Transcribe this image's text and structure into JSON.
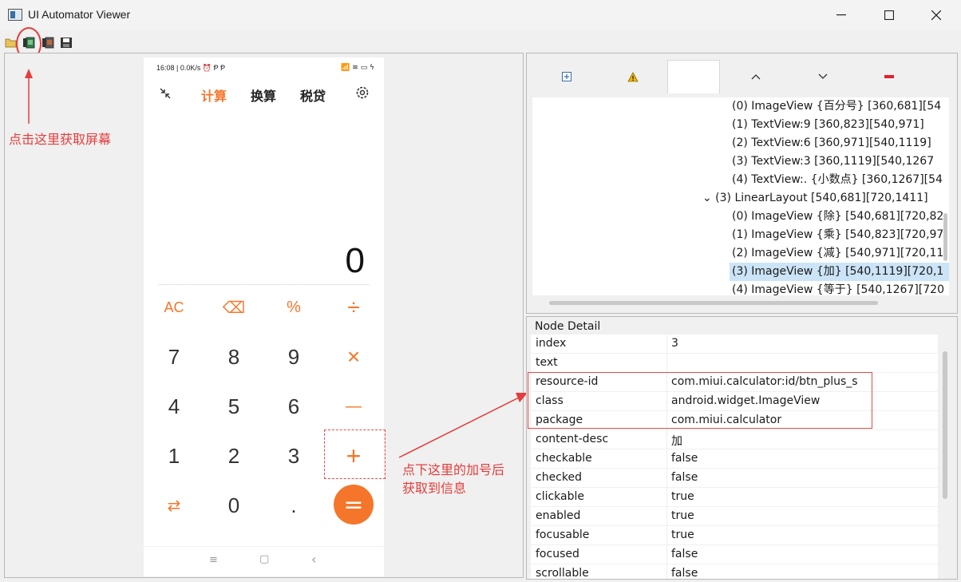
{
  "window": {
    "title": "UI Automator Viewer"
  },
  "toolbar": {
    "icons": [
      "open-folder-icon",
      "device-screenshot-icon",
      "device-screenshot-compressed-icon",
      "save-icon"
    ]
  },
  "phone": {
    "status_left": "16:08 | 0.0K/s ⏰ Ᵽ Ᵽ",
    "status_right": "📶 ≋ ▭ ϟ",
    "tabs": [
      "计算",
      "换算",
      "税贷"
    ],
    "display": "0",
    "keys": [
      [
        "AC",
        "⌫",
        "%",
        "÷"
      ],
      [
        "7",
        "8",
        "9",
        "×"
      ],
      [
        "4",
        "5",
        "6",
        "—"
      ],
      [
        "1",
        "2",
        "3",
        "+"
      ],
      [
        "⇄",
        "0",
        ".",
        "="
      ]
    ],
    "nav": [
      "≡",
      "▢",
      "‹"
    ]
  },
  "annotations": {
    "capture_hint": "点击这里获取屏幕",
    "plus_hint_line1": "点下这里的加号后",
    "plus_hint_line2": "获取到信息"
  },
  "hierarchy": {
    "rows": [
      {
        "text": "(0) ImageView {百分号} [360,681][54",
        "indent": 2
      },
      {
        "text": "(1) TextView:9 [360,823][540,971]",
        "indent": 2
      },
      {
        "text": "(2) TextView:6 [360,971][540,1119]",
        "indent": 2
      },
      {
        "text": "(3) TextView:3 [360,1119][540,1267",
        "indent": 2
      },
      {
        "text": "(4) TextView:. {小数点} [360,1267][54",
        "indent": 2
      },
      {
        "text": "⌄ (3) LinearLayout [540,681][720,1411]",
        "indent": 1
      },
      {
        "text": "(0) ImageView {除} [540,681][720,82",
        "indent": 2
      },
      {
        "text": "(1) ImageView {乘} [540,823][720,97",
        "indent": 2
      },
      {
        "text": "(2) ImageView {减} [540,971][720,11",
        "indent": 2
      },
      {
        "text": "(3) ImageView {加} [540,1119][720,1",
        "indent": 2,
        "selected": true
      },
      {
        "text": "(4) ImageView {等于} [540,1267][720",
        "indent": 2
      }
    ]
  },
  "node_detail": {
    "title": "Node Detail",
    "rows": [
      {
        "key": "index",
        "value": "3"
      },
      {
        "key": "text",
        "value": ""
      },
      {
        "key": "resource-id",
        "value": "com.miui.calculator:id/btn_plus_s"
      },
      {
        "key": "class",
        "value": "android.widget.ImageView"
      },
      {
        "key": "package",
        "value": "com.miui.calculator"
      },
      {
        "key": "content-desc",
        "value": "加"
      },
      {
        "key": "checkable",
        "value": "false"
      },
      {
        "key": "checked",
        "value": "false"
      },
      {
        "key": "clickable",
        "value": "true"
      },
      {
        "key": "enabled",
        "value": "true"
      },
      {
        "key": "focusable",
        "value": "true"
      },
      {
        "key": "focused",
        "value": "false"
      },
      {
        "key": "scrollable",
        "value": "false"
      }
    ]
  },
  "colors": {
    "accent_orange": "#f5762a",
    "annotation_red": "#e63c3c",
    "selection": "#cce4f7"
  }
}
